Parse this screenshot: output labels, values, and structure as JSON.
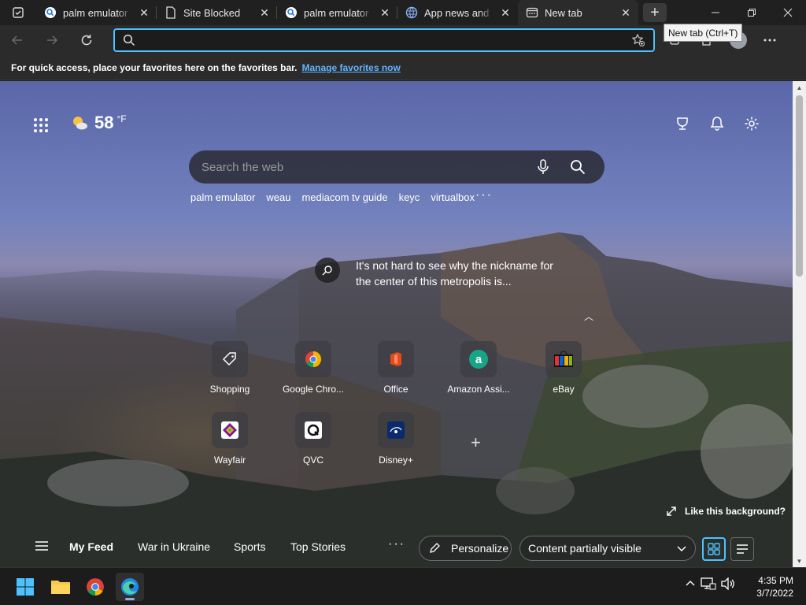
{
  "tabs": [
    {
      "title": "palm emulator - ",
      "icon": "search-icon",
      "active": false
    },
    {
      "title": "Site Blocked",
      "icon": "document-icon",
      "active": false
    },
    {
      "title": "palm emulator - ",
      "icon": "search-icon",
      "active": false
    },
    {
      "title": "App news and r",
      "icon": "globe-icon",
      "active": false
    },
    {
      "title": "New tab",
      "icon": "newtab-icon",
      "active": true
    }
  ],
  "tooltip": "New tab (Ctrl+T)",
  "address": {
    "value": "",
    "placeholder": ""
  },
  "favorites_bar": {
    "message": "For quick access, place your favorites here on the favorites bar.",
    "link": "Manage favorites now"
  },
  "weather": {
    "temp": "58",
    "unit": "°F",
    "icon": "partly-cloudy-icon"
  },
  "search": {
    "placeholder": "Search the web"
  },
  "suggestions": [
    "palm emulator",
    "weau",
    "mediacom tv guide",
    "keyc",
    "virtualbox"
  ],
  "background_info": {
    "text": "It's not hard to see why the nickname for the center of this metropolis is..."
  },
  "quick_links": [
    {
      "label": "Shopping",
      "icon": "tag-icon"
    },
    {
      "label": "Google Chro...",
      "icon": "chrome-icon"
    },
    {
      "label": "Office",
      "icon": "office-icon"
    },
    {
      "label": "Amazon Assi...",
      "icon": "amazon-icon"
    },
    {
      "label": "eBay",
      "icon": "ebay-icon"
    },
    {
      "label": "Wayfair",
      "icon": "wayfair-icon"
    },
    {
      "label": "QVC",
      "icon": "qvc-icon"
    },
    {
      "label": "Disney+",
      "icon": "disney-icon"
    }
  ],
  "like_background": "Like this background?",
  "feed": {
    "items": [
      "My Feed",
      "War in Ukraine",
      "Sports",
      "Top Stories"
    ],
    "personalize": "Personalize",
    "content_visibility": "Content partially visible"
  },
  "clock": {
    "time": "4:35 PM",
    "date": "3/7/2022"
  },
  "colors": {
    "accent": "#4cc2ff",
    "link": "#60b4ff",
    "tab_bg": "#202020",
    "toolbar_bg": "#2b2b2b"
  }
}
